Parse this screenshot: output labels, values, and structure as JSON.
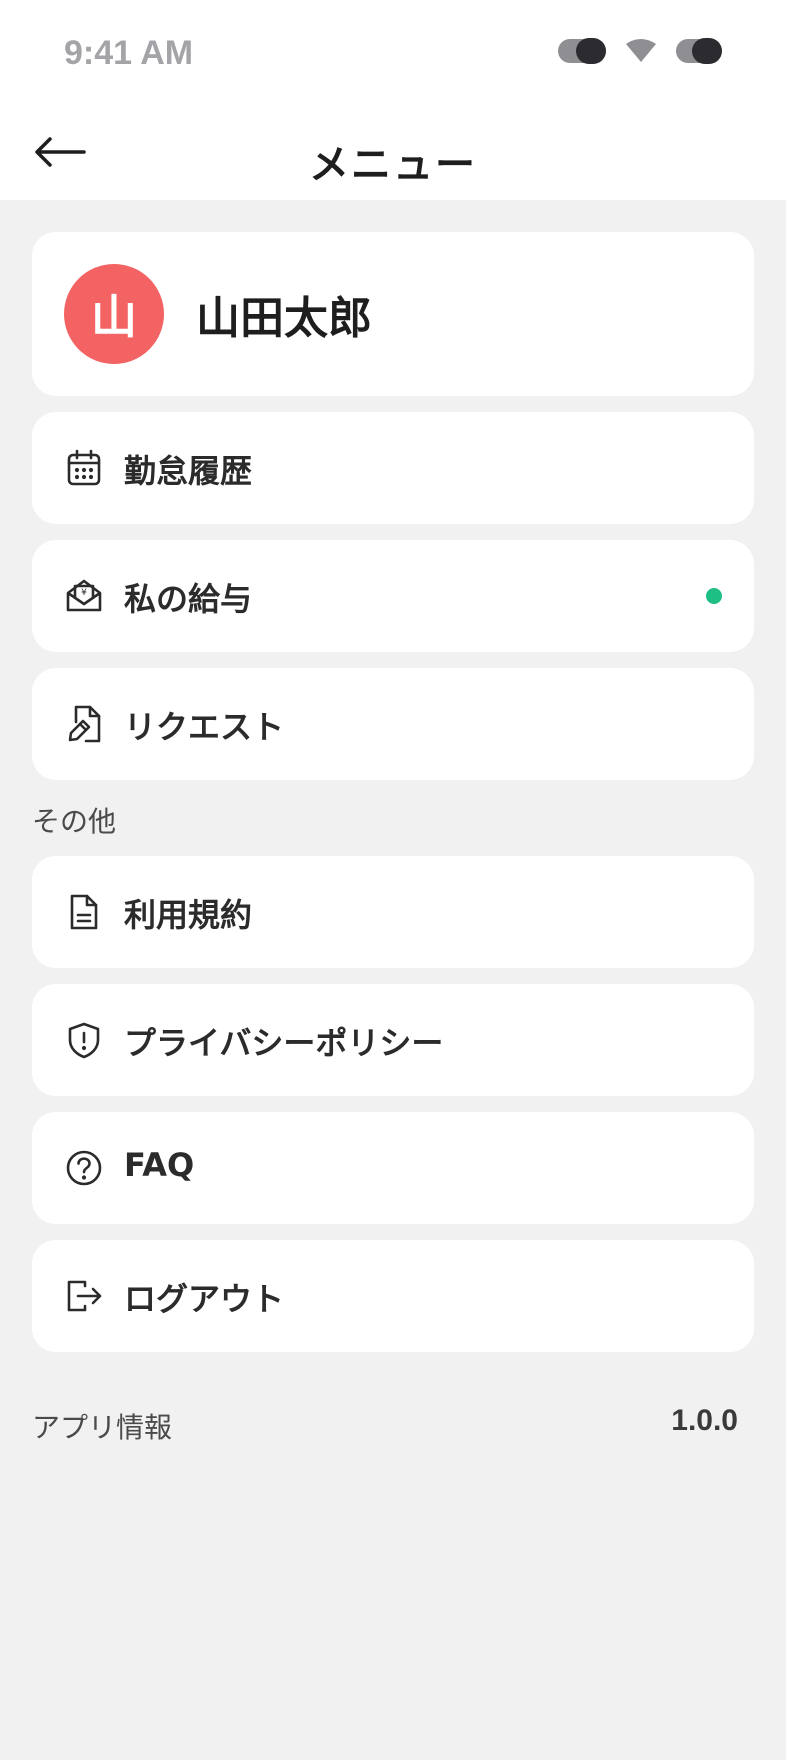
{
  "status_bar": {
    "time": "9:41 AM"
  },
  "header": {
    "title": "メニュー",
    "back_icon": "arrow-left-icon"
  },
  "profile": {
    "avatar_initial": "山",
    "name": "山田太郎",
    "avatar_color": "#f36363"
  },
  "menu": [
    {
      "label": "勤怠履歴",
      "icon": "calendar-icon"
    },
    {
      "label": "私の給与",
      "icon": "payslip-envelope-icon",
      "badge_color": "#1dbf85"
    },
    {
      "label": "リクエスト",
      "icon": "document-edit-icon"
    }
  ],
  "other_section": {
    "title": "その他",
    "items": [
      {
        "label": "利用規約",
        "icon": "document-icon"
      },
      {
        "label": "プライバシーポリシー",
        "icon": "shield-alert-icon"
      },
      {
        "label": "FAQ",
        "icon": "question-circle-icon"
      },
      {
        "label": "ログアウト",
        "icon": "logout-icon"
      }
    ]
  },
  "footer": {
    "label": "アプリ情報",
    "version": "1.0.0"
  }
}
